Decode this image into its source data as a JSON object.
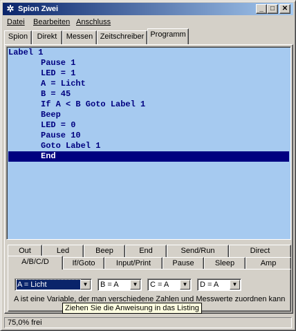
{
  "window": {
    "title": "Spion Zwei",
    "icon": "gear-icon"
  },
  "titlebar_buttons": {
    "minimize": "_",
    "maximize": "□",
    "close": "✕"
  },
  "menu": {
    "datei": "Datei",
    "bearbeiten": "Bearbeiten",
    "anschluss": "Anschluss"
  },
  "tabs": {
    "spion": "Spion",
    "direkt": "Direkt",
    "messen": "Messen",
    "zeitschreiber": "Zeitschreiber",
    "programm": "Programm"
  },
  "listing": {
    "lines": [
      "Label 1",
      "Pause 1",
      "LED = 1",
      "A = Licht",
      "B = 45",
      "If A < B Goto Label 1",
      "Beep",
      "LED = 0",
      "Pause 10",
      "Goto Label 1",
      "End"
    ],
    "selected_index": 10,
    "highlight_color": "#000080",
    "background_color": "#a6caf0"
  },
  "command_tabs": {
    "row1": [
      "Out",
      "Led",
      "Beep",
      "End",
      "Send/Run",
      "Direct"
    ],
    "row2": [
      "A/B/C/D",
      "If/Goto",
      "Input/Print",
      "Pause",
      "Sleep",
      "Amp"
    ]
  },
  "combos": {
    "a": "A = Licht",
    "b": "B = A",
    "c": "C = A",
    "d": "D = A"
  },
  "hint": "A ist eine Variable, der man verschiedene Zahlen und Messwerte zuordnen kann",
  "tooltip": "Ziehen Sie die Anweisung in das Listing",
  "status": "75,0% frei"
}
